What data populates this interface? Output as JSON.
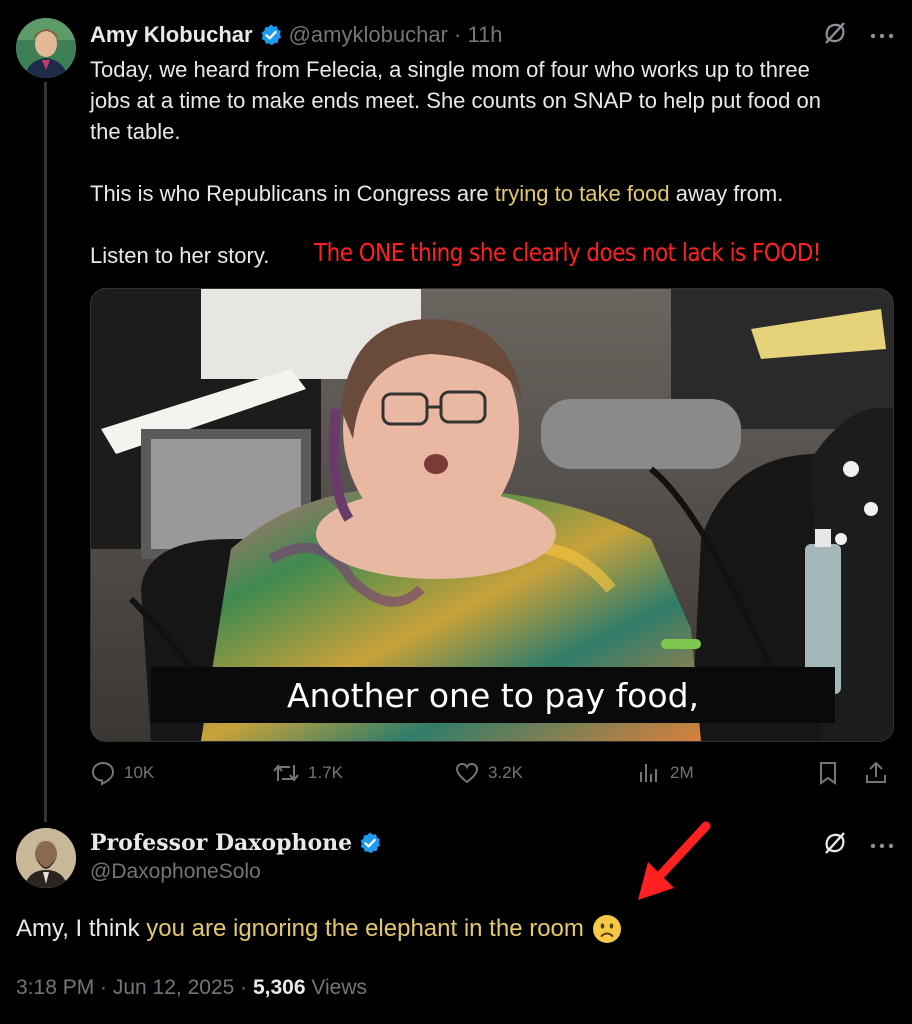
{
  "post": {
    "author_name": "Amy Klobuchar",
    "handle": "@amyklobuchar",
    "separator": "·",
    "time": "11h",
    "text_line1": "Today, we heard from Felecia, a single mom of four who works up to three",
    "text_line2": "jobs at a time to make ends meet. She counts on SNAP to help put food on",
    "text_line3": "the table.",
    "text_p2_before": "This is who Republicans in Congress are ",
    "text_p2_link": "trying to take food",
    "text_p2_after": " away from.",
    "text_p3": "Listen to her story.",
    "overlay_annotation": "The ONE thing she clearly does not lack is FOOD!",
    "video_caption": "Another one to pay food,",
    "stats": {
      "replies": "10K",
      "reposts": "1.7K",
      "likes": "3.2K",
      "views": "2M"
    },
    "icons": {
      "verified": "verified-badge-icon",
      "grok": "grok-icon",
      "more": "more-icon",
      "reply": "reply-icon",
      "repost": "repost-icon",
      "like": "heart-icon",
      "views": "views-chart-icon",
      "bookmark": "bookmark-icon",
      "share": "share-icon"
    }
  },
  "reply": {
    "author_name": "Professor Daxophone",
    "handle": "@DaxophoneSolo",
    "text_before": "Amy, I think ",
    "text_highlight": "you are ignoring the elephant in the room",
    "emoji": "slightly-frowning-face-emoji",
    "timestamp": "3:18 PM · Jun 12, 2025 · ",
    "view_count": "5,306",
    "views_label": " Views"
  },
  "colors": {
    "background": "#000000",
    "text": "#e7e9ea",
    "muted": "#71767b",
    "verified": "#1d9bf0",
    "highlight": "#e4c96a",
    "annotation_red": "#ff2222"
  }
}
